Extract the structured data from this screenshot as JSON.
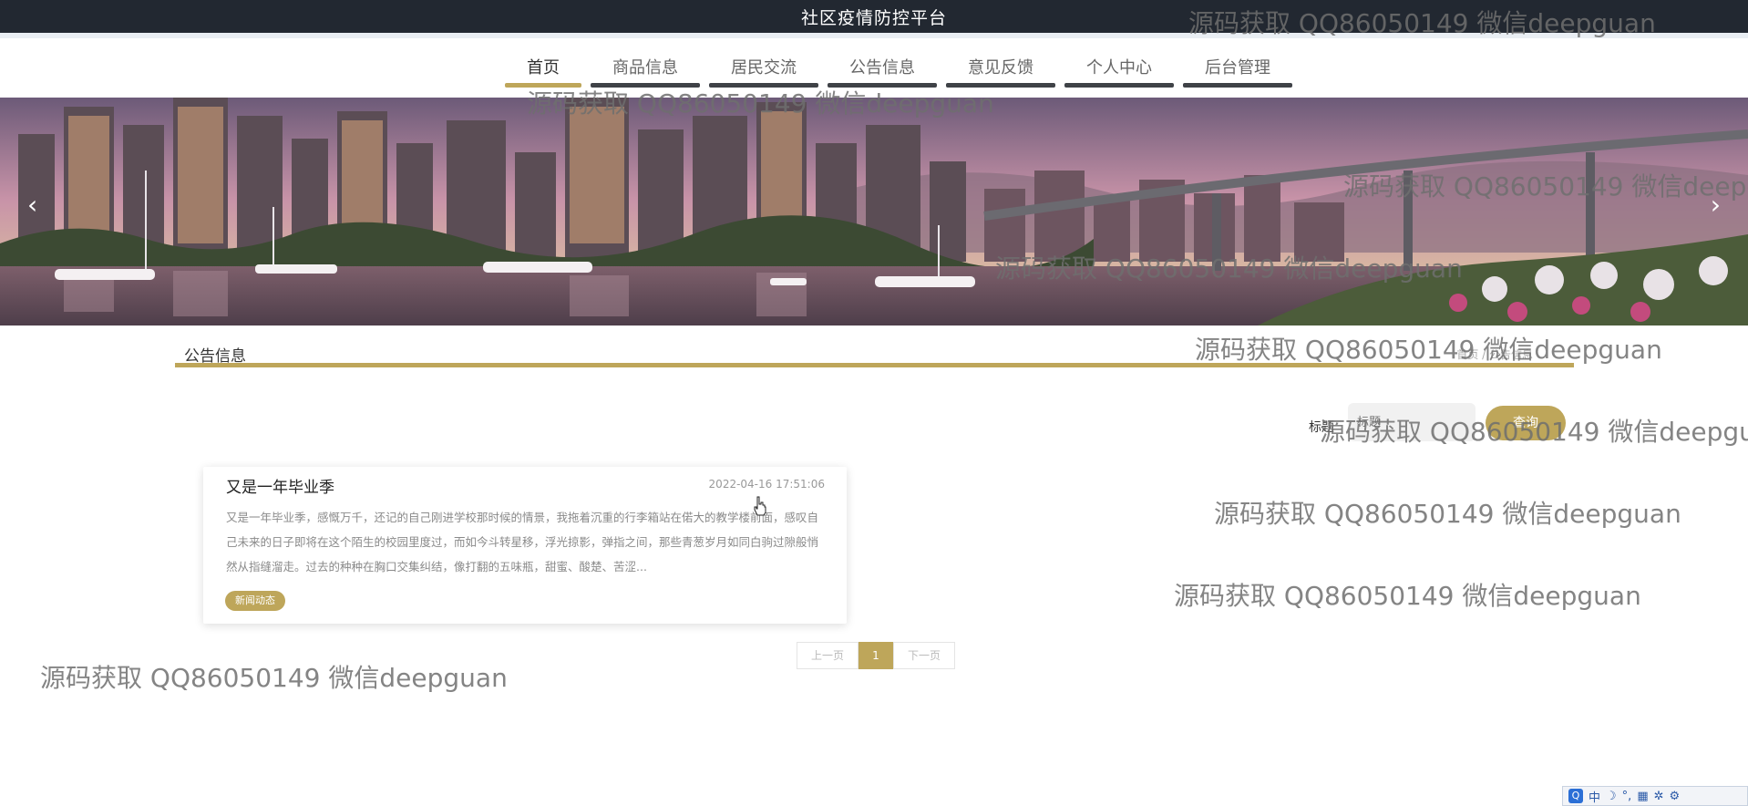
{
  "header": {
    "title": "社区疫情防控平台"
  },
  "nav": {
    "items": [
      {
        "label": "首页",
        "active": true
      },
      {
        "label": "商品信息"
      },
      {
        "label": "居民交流"
      },
      {
        "label": "公告信息"
      },
      {
        "label": "意见反馈"
      },
      {
        "label": "个人中心"
      },
      {
        "label": "后台管理"
      }
    ]
  },
  "banner": {
    "prev_icon": "‹",
    "next_icon": "›"
  },
  "section": {
    "title": "公告信息",
    "breadcrumb": "首页 / 公告信息"
  },
  "search": {
    "label": "标题",
    "placeholder": "标题",
    "button_label": "查询"
  },
  "news": {
    "items": [
      {
        "title": "又是一年毕业季",
        "time": "2022-04-16 17:51:06",
        "summary": "又是一年毕业季，感慨万千，还记的自己刚进学校那时候的情景，我拖着沉重的行李箱站在偌大的教学楼前面，感叹自己未来的日子即将在这个陌生的校园里度过，而如今斗转星移，浮光掠影，弹指之间，那些青葱岁月如同白驹过隙般悄然从指缝溜走。过去的种种在胸口交集纠结，像打翻的五味瓶，甜蜜、酸楚、苦涩...",
        "tag": "新闻动态"
      }
    ]
  },
  "pagination": {
    "prev_label": "上一页",
    "current": "1",
    "next_label": "下一页"
  },
  "watermark": {
    "text": "源码获取 QQ86050149 微信deepguan"
  },
  "ime": {
    "logo": "Q",
    "mode": "中",
    "moon": "☽",
    "punct": "°,",
    "keyboard": "▦",
    "tools": "✲",
    "settings": "⚙"
  },
  "colors": {
    "accent": "#bea65a",
    "header_bg": "#222831",
    "nav_underline": "#3f4247"
  }
}
